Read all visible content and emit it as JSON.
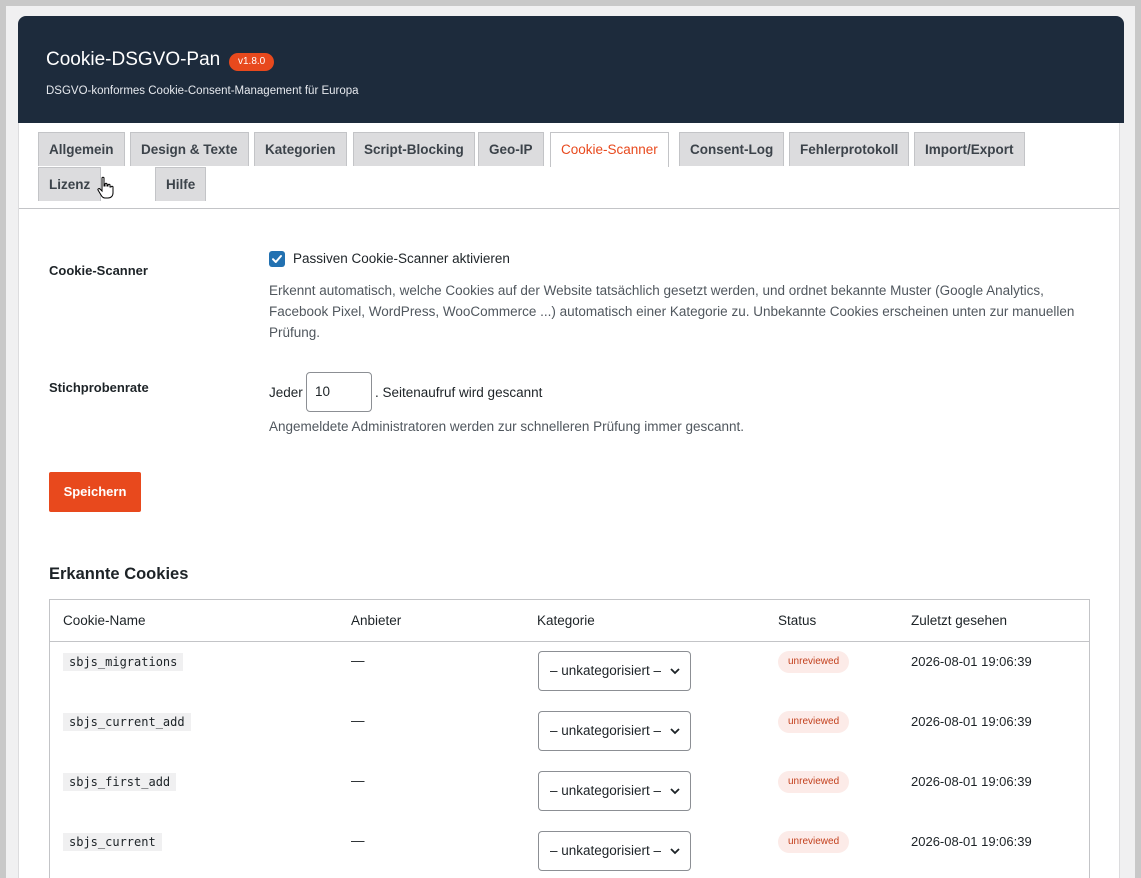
{
  "header": {
    "title": "Cookie-DSGVO-Pan",
    "version": "v1.8.0",
    "subtitle": "DSGVO-konformes Cookie-Consent-Management für Europa"
  },
  "tabs": [
    {
      "label": "Allgemein",
      "active": false
    },
    {
      "label": "Design & Texte",
      "active": false
    },
    {
      "label": "Kategorien",
      "active": false
    },
    {
      "label": "Script-Blocking",
      "active": false
    },
    {
      "label": "Geo-IP",
      "active": false
    },
    {
      "label": "Cookie-Scanner",
      "active": true
    },
    {
      "label": "Consent-Log",
      "active": false
    },
    {
      "label": "Fehlerprotokoll",
      "active": false
    },
    {
      "label": "Import/Export",
      "active": false
    },
    {
      "label": "Lizenz",
      "active": false
    },
    {
      "label": "Hilfe",
      "active": false
    }
  ],
  "settings": {
    "scanner_label": "Cookie-Scanner",
    "scanner_checkbox_label": "Passiven Cookie-Scanner aktivieren",
    "scanner_checked": true,
    "scanner_description": "Erkennt automatisch, welche Cookies auf der Website tatsächlich gesetzt werden, und ordnet bekannte Muster (Google Analytics, Facebook Pixel, WordPress, WooCommerce ...) automatisch einer Kategorie zu. Unbekannte Cookies erscheinen unten zur manuellen Prüfung.",
    "sample_label": "Stichprobenrate",
    "sample_prefix": "Jeder",
    "sample_value": "10",
    "sample_suffix": ". Seitenaufruf wird gescannt",
    "sample_description": "Angemeldete Administratoren werden zur schnelleren Prüfung immer gescannt.",
    "save_label": "Speichern"
  },
  "cookies": {
    "title": "Erkannte Cookies",
    "columns": {
      "name": "Cookie-Name",
      "provider": "Anbieter",
      "category": "Kategorie",
      "status": "Status",
      "last_seen": "Zuletzt gesehen"
    },
    "rows": [
      {
        "name": "sbjs_migrations",
        "provider": "—",
        "category": "– unkategorisiert –",
        "status": "unreviewed",
        "last_seen": "2026-08-01 19:06:39"
      },
      {
        "name": "sbjs_current_add",
        "provider": "—",
        "category": "– unkategorisiert –",
        "status": "unreviewed",
        "last_seen": "2026-08-01 19:06:39"
      },
      {
        "name": "sbjs_first_add",
        "provider": "—",
        "category": "– unkategorisiert –",
        "status": "unreviewed",
        "last_seen": "2026-08-01 19:06:39"
      },
      {
        "name": "sbjs_current",
        "provider": "—",
        "category": "– unkategorisiert –",
        "status": "unreviewed",
        "last_seen": "2026-08-01 19:06:39"
      }
    ]
  },
  "colors": {
    "header_bg": "#1d2b3c",
    "accent": "#e8491d",
    "checkbox": "#2271b1"
  }
}
